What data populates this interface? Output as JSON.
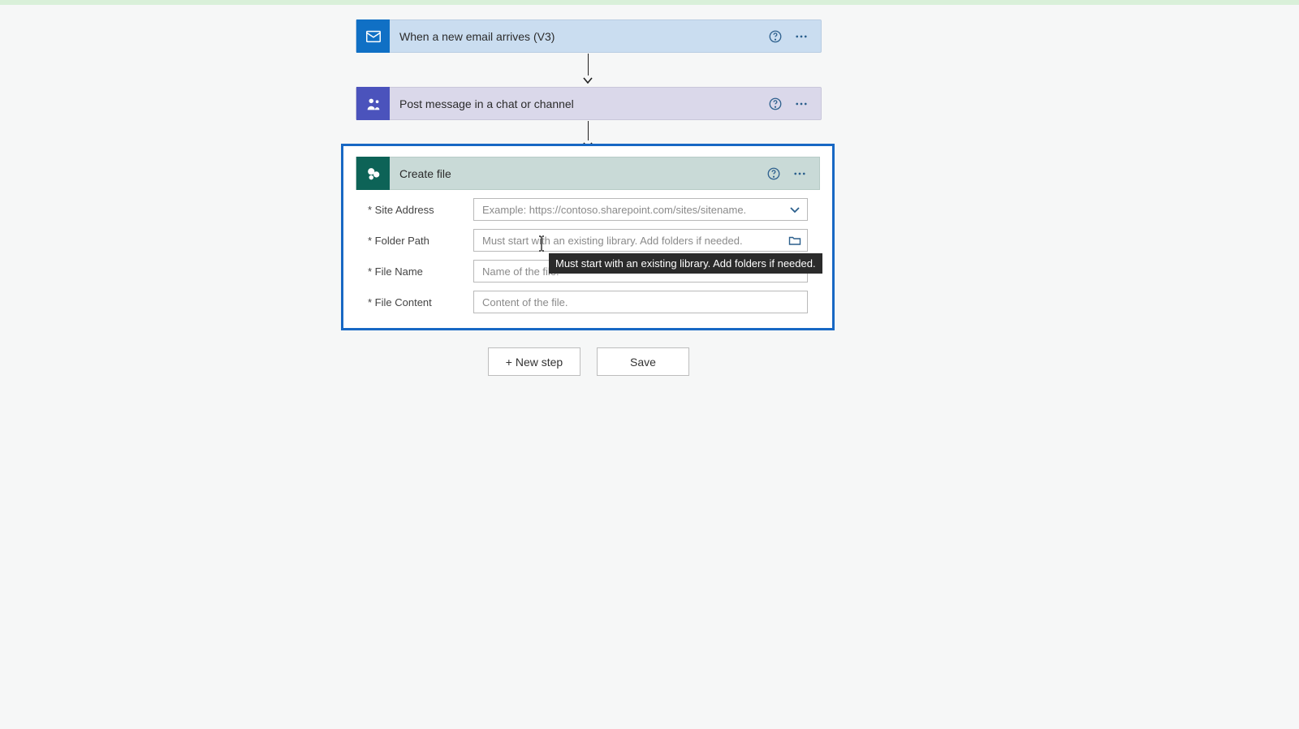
{
  "steps": {
    "trigger": {
      "title": "When a new email arrives (V3)"
    },
    "action1": {
      "title": "Post message in a chat or channel"
    },
    "action2": {
      "title": "Create file",
      "fields": {
        "siteAddress": {
          "label": "Site Address",
          "placeholder": "Example: https://contoso.sharepoint.com/sites/sitename."
        },
        "folderPath": {
          "label": "Folder Path",
          "placeholder": "Must start with an existing library. Add folders if needed."
        },
        "fileName": {
          "label": "File Name",
          "placeholder": "Name of the file."
        },
        "fileContent": {
          "label": "File Content",
          "placeholder": "Content of the file."
        }
      },
      "tooltip": "Must start with an existing library. Add folders if needed."
    }
  },
  "buttons": {
    "newStep": "+ New step",
    "save": "Save"
  }
}
